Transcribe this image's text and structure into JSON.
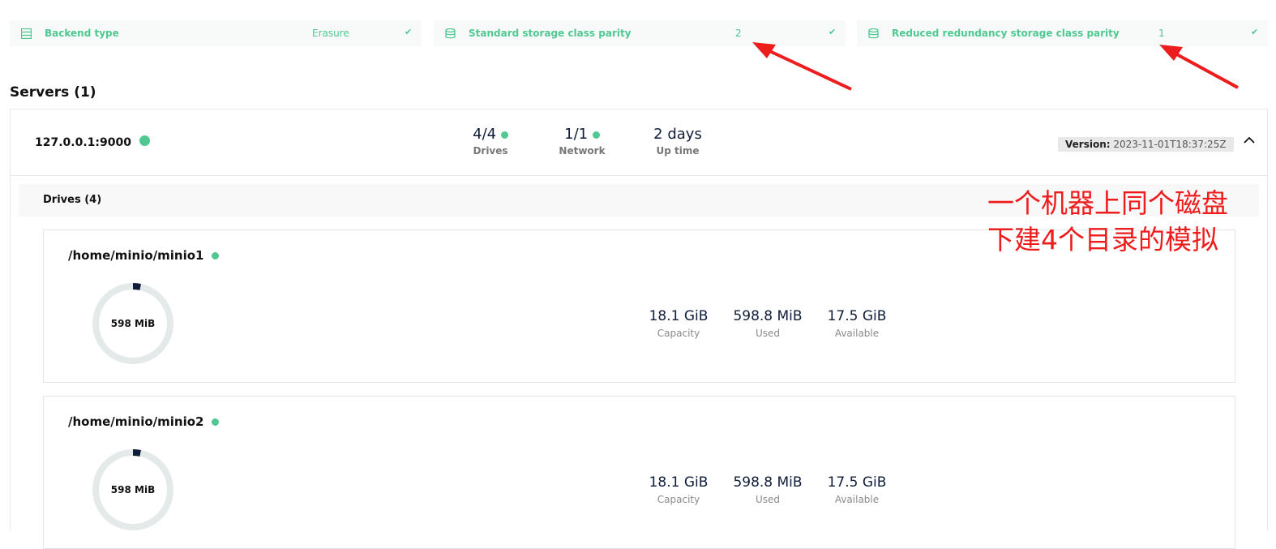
{
  "info_cards": [
    {
      "label": "Backend type",
      "value": "Erasure",
      "icon": "list-icon",
      "status_icon": "check-icon"
    },
    {
      "label": "Standard storage class parity",
      "value": "2",
      "icon": "database-icon",
      "status_icon": "check-icon"
    },
    {
      "label": "Reduced redundancy storage class parity",
      "value": "1",
      "icon": "database-icon",
      "status_icon": "check-icon"
    }
  ],
  "servers": {
    "title": "Servers (1)",
    "server": {
      "host": "127.0.0.1:9000",
      "drives_value": "4/4",
      "drives_label": "Drives",
      "network_value": "1/1",
      "network_label": "Network",
      "uptime_value": "2 days",
      "uptime_label": "Up time",
      "version_label": "Version:",
      "version_value": "2023-11-01T18:37:25Z"
    },
    "drives_header": "Drives (4)",
    "drives": [
      {
        "path": "/home/minio/minio1",
        "ring_label": "598 MiB",
        "capacity": "18.1 GiB",
        "capacity_label": "Capacity",
        "used": "598.8 MiB",
        "used_label": "Used",
        "available": "17.5 GiB",
        "available_label": "Available",
        "usage_fraction": 0.032
      },
      {
        "path": "/home/minio/minio2",
        "ring_label": "598 MiB",
        "capacity": "18.1 GiB",
        "capacity_label": "Capacity",
        "used": "598.8 MiB",
        "used_label": "Used",
        "available": "17.5 GiB",
        "available_label": "Available",
        "usage_fraction": 0.032
      }
    ]
  },
  "annotation": {
    "line1": "一个机器上同个磁盘",
    "line2": "下建4个目录的模拟"
  },
  "colors": {
    "accent": "#4fc892",
    "annotation": "#ee1d1d",
    "ring_used": "#0f1c3a",
    "ring_track": "#e4e9ea"
  }
}
